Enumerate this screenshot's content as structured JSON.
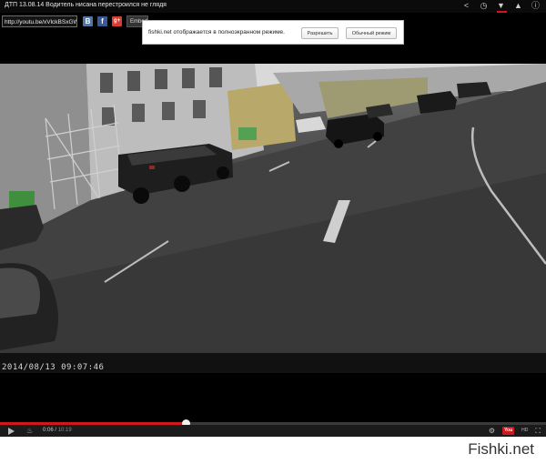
{
  "player": {
    "title": "ДТП 13.08.14 Водитель нисана перестроился не глядя",
    "share_url": "http://youtu.be/xVlckBSxGWI",
    "embed_label": "Embed",
    "timestamp_overlay": "2014/08/13  09:07:46",
    "current_time": "0:06",
    "duration": "10:19",
    "progress": 0.34
  },
  "popup": {
    "message": "fishki.net отображается в полноэкранном режиме.",
    "allow_label": "Разрешить",
    "normal_label": "Обычный режим"
  },
  "watermark": "Fishki.net",
  "icons": {
    "top": [
      "share-icon",
      "clock-icon",
      "thumbs-down-icon",
      "thumbs-up-icon",
      "info-icon"
    ],
    "controls": [
      "play-icon",
      "volume-icon",
      "settings-icon",
      "youtube-icon",
      "hd-icon",
      "fullscreen-icon"
    ]
  },
  "colors": {
    "accent": "#cc181e",
    "vk": "#4f77a9",
    "facebook": "#3b5998",
    "googleplus": "#d73d32"
  }
}
